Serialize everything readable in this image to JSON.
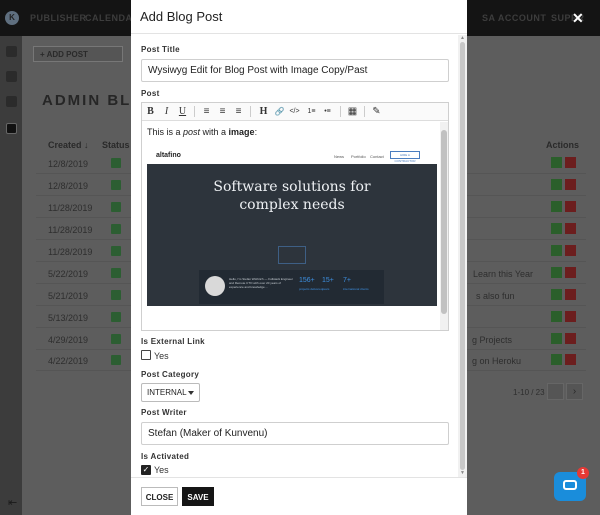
{
  "app": {
    "logo_letter": "K",
    "nav": [
      "PUBLISHER",
      "CALENDAR",
      "SA ACCOUNT",
      "SUPER"
    ],
    "add_post_label": "ADD POST",
    "page_title": "ADMIN BLOG",
    "columns": [
      "Created",
      "Status",
      "Actions"
    ],
    "sort_glyph": "↓",
    "rows": [
      {
        "date": "12/8/2019",
        "title": ""
      },
      {
        "date": "12/8/2019",
        "title": ""
      },
      {
        "date": "11/28/2019",
        "title": ""
      },
      {
        "date": "11/28/2019",
        "title": ""
      },
      {
        "date": "11/28/2019",
        "title": ""
      },
      {
        "date": "5/22/2019",
        "title": "Learn this Year"
      },
      {
        "date": "5/21/2019",
        "title": "s also fun"
      },
      {
        "date": "5/13/2019",
        "title": ""
      },
      {
        "date": "4/29/2019",
        "title": "g Projects"
      },
      {
        "date": "4/22/2019",
        "title": "g on Heroku"
      }
    ],
    "pager_text": "1-10 / 23",
    "pager_next": "›",
    "collapse_glyph": "⇤",
    "close_glyph": "✕"
  },
  "modal": {
    "title": "Add Blog Post",
    "post_title_label": "Post Title",
    "post_title_value": "Wysiwyg Edit for Blog Post with Image Copy/Past",
    "post_label": "Post",
    "toolbar": [
      "B",
      "I",
      "U",
      "≡",
      "≡",
      "≡",
      "H",
      "🔗",
      "</>",
      "1≡",
      "•≡",
      "▦",
      "✎"
    ],
    "editor_text_before": "This is a ",
    "editor_text_em": "post",
    "editor_text_mid": " with a ",
    "editor_text_strong": "image",
    "editor_text_after": ":",
    "preview": {
      "logo": "altafino",
      "nav": [
        "News",
        "Portfolio",
        "Contact"
      ],
      "button": "HIRE A CONTRACTOR",
      "headline_line1": "Software solutions for",
      "headline_line2": "complex needs",
      "bio": "Hello, I'm Stefan Wüthrich — Fullstack Engineer and Remote CTO with over 20 years of experience and knowledge ...",
      "stats": [
        {
          "value": "156+",
          "label": "projects delivered"
        },
        {
          "value": "15+",
          "label": "years"
        },
        {
          "value": "7+",
          "label": "international clients"
        }
      ]
    },
    "external_link_label": "Is External Link",
    "external_link_option": "Yes",
    "external_link_checked": false,
    "category_label": "Post Category",
    "category_value": "INTERNAL",
    "writer_label": "Post Writer",
    "writer_value": "Stefan (Maker of Kunvenu)",
    "activated_label": "Is Activated",
    "activated_option": "Yes",
    "activated_checked": true,
    "check_glyph": "✓",
    "close_button": "CLOSE",
    "save_button": "SAVE"
  },
  "chat": {
    "badge_count": "1"
  },
  "colors": {
    "primary_button": "#151515",
    "chat_widget": "#1a8ddb",
    "badge": "#e53935"
  }
}
